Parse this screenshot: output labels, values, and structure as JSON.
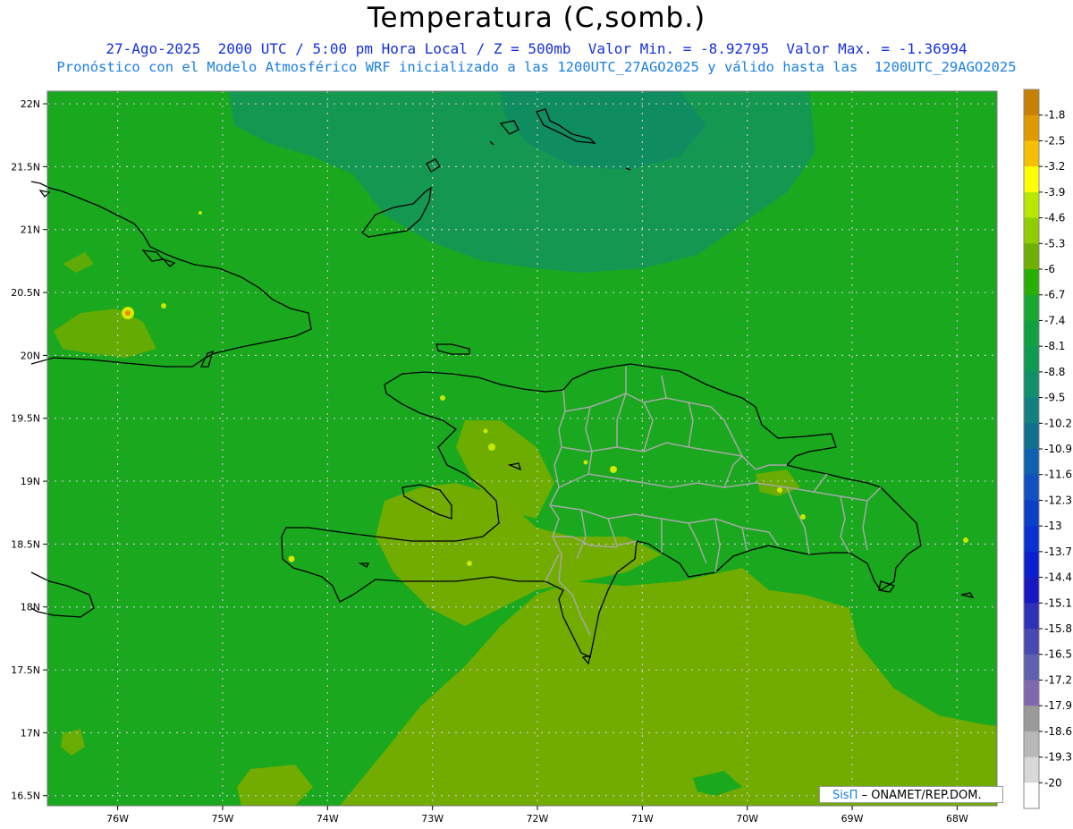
{
  "title": "Temperatura (C,somb.)",
  "subtitle_line1": "27-Ago-2025  2000 UTC / 5:00 pm Hora Local / Z = 500mb  Valor Min. = -8.92795  Valor Max. = -1.36994",
  "subtitle_line2": "Pronóstico con el Modelo Atmosférico WRF inicializado a las 1200UTC_27AGO2025 y válido hasta las  1200UTC_29AGO2025",
  "x_axis": {
    "ticks": [
      "76W",
      "75W",
      "74W",
      "73W",
      "72W",
      "71W",
      "70W",
      "69W",
      "68W"
    ],
    "values": [
      -76,
      -75,
      -74,
      -73,
      -72,
      -71,
      -70,
      -69,
      -68
    ],
    "range": [
      -76.67,
      -67.62
    ]
  },
  "y_axis": {
    "ticks": [
      "22N",
      "21.5N",
      "21N",
      "20.5N",
      "20N",
      "19.5N",
      "19N",
      "18.5N",
      "18N",
      "17.5N",
      "17N",
      "16.5N"
    ],
    "values": [
      22,
      21.5,
      21,
      20.5,
      20,
      19.5,
      19,
      18.5,
      18,
      17.5,
      17,
      16.5
    ],
    "range": [
      16.42,
      22.1
    ]
  },
  "colorbar": {
    "labels": [
      "-1.8",
      "-2.5",
      "-3.2",
      "-3.9",
      "-4.6",
      "-5.3",
      "-6",
      "-6.7",
      "-7.4",
      "-8.1",
      "-8.8",
      "-9.5",
      "-10.2",
      "-10.9",
      "-11.6",
      "-12.3",
      "-13",
      "-13.7",
      "-14.4",
      "-15.1",
      "-15.8",
      "-16.5",
      "-17.2",
      "-17.9",
      "-18.6",
      "-19.3",
      "-20"
    ],
    "colors": [
      "#c88000",
      "#e09a00",
      "#f5c000",
      "#ffff00",
      "#b8e800",
      "#8fcc00",
      "#6fb000",
      "#28b000",
      "#19a830",
      "#10a040",
      "#0d9a55",
      "#10906a",
      "#108080",
      "#107090",
      "#1060b0",
      "#1050c0",
      "#0a40c8",
      "#0a30d0",
      "#0a20d0",
      "#1818c0",
      "#3030b8",
      "#4848b0",
      "#6060b0",
      "#8068b0",
      "#9a9a9a",
      "#b8b8b8",
      "#d8d8d8",
      "#ffffff"
    ]
  },
  "field_colors": {
    "base": "#19a81e",
    "dark_north": "#14955a",
    "light_south": "#72ac00",
    "yellow_spot": "#d8e800"
  },
  "credit": {
    "logo": "SisΠ",
    "text": "– ONAMET/REP.DOM."
  }
}
